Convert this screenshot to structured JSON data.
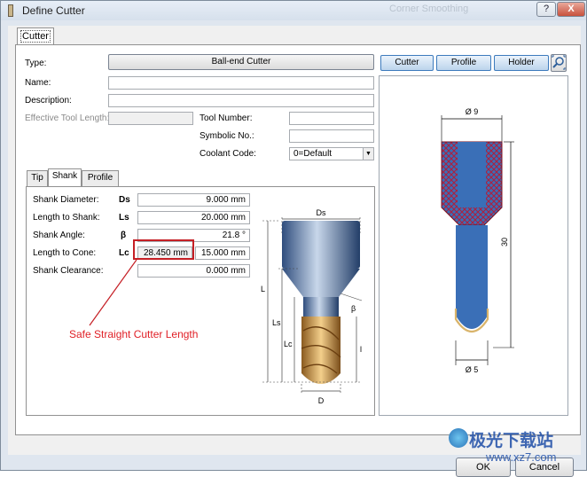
{
  "window": {
    "title": "Define Cutter",
    "bg_title_ghost": "Corner Smoothing",
    "help_label": "?",
    "close_label": "X"
  },
  "tabs": {
    "main": "Cutter"
  },
  "form": {
    "type_label": "Type:",
    "type_value": "Ball-end Cutter",
    "name_label": "Name:",
    "name_value": "",
    "description_label": "Description:",
    "description_value": "",
    "effective_length_label": "Effective Tool Length:",
    "effective_length_value": "",
    "tool_number_label": "Tool Number:",
    "tool_number_value": "",
    "symbolic_no_label": "Symbolic No.:",
    "symbolic_no_value": "",
    "coolant_label": "Coolant Code:",
    "coolant_value": "0=Default"
  },
  "view_buttons": [
    "Cutter",
    "Profile",
    "Holder"
  ],
  "subtabs": [
    "Tip",
    "Shank",
    "Profile"
  ],
  "shank": {
    "rows": [
      {
        "label": "Shank Diameter:",
        "symbol": "Ds",
        "value": "9.000 mm"
      },
      {
        "label": "Length to Shank:",
        "symbol": "Ls",
        "value": "20.000 mm"
      },
      {
        "label": "Shank Angle:",
        "symbol": "β",
        "value": "21.8 °"
      },
      {
        "label": "Length to Cone:",
        "symbol": "Lc",
        "value": "15.000 mm",
        "extra": "28.450 mm"
      },
      {
        "label": "Shank Clearance:",
        "symbol": "",
        "value": "0.000 mm"
      }
    ]
  },
  "diagram_labels": {
    "ds": "Ds",
    "beta": "β",
    "l": "L",
    "ls": "Ls",
    "lc": "Lc",
    "l_small": "l",
    "d": "D"
  },
  "profile_labels": {
    "top_dia": "Ø 9",
    "length": "30",
    "tip_dia": "Ø 5"
  },
  "annotation": "Safe Straight Cutter Length",
  "buttons": {
    "ok": "OK",
    "cancel": "Cancel"
  },
  "watermark": {
    "main": "极光下载站",
    "url": "www.xz7.com"
  },
  "colors": {
    "highlight_red": "#c51f25",
    "annotation_red": "#e01f26",
    "profile_blue": "#3a6fb7",
    "profile_red": "#b01d3a",
    "accent_blue": "#3d7bbd"
  }
}
